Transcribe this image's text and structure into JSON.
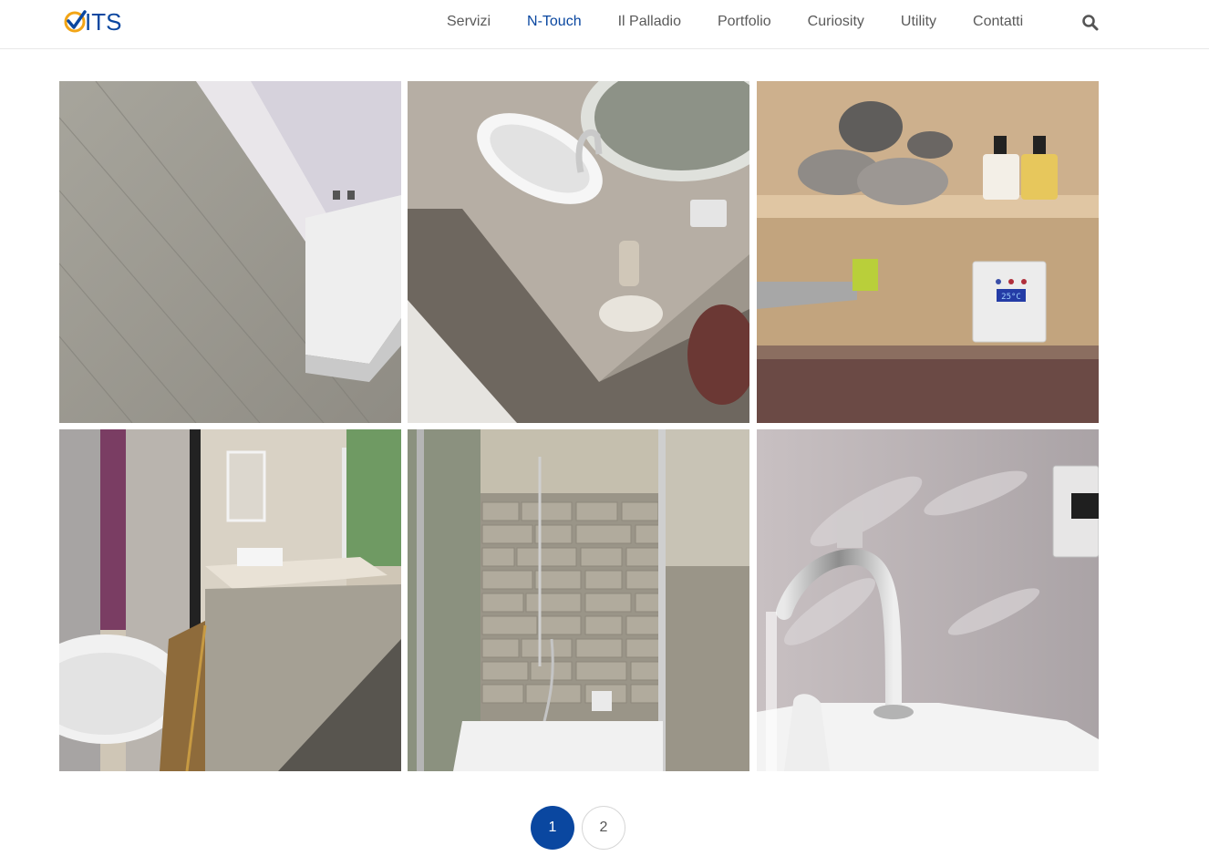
{
  "brand": {
    "logo_text": "ITS"
  },
  "nav": {
    "items": [
      {
        "label": "Servizi",
        "active": false
      },
      {
        "label": "N-Touch",
        "active": true
      },
      {
        "label": "Il Palladio",
        "active": false
      },
      {
        "label": "Portfolio",
        "active": false
      },
      {
        "label": "Curiosity",
        "active": false
      },
      {
        "label": "Utility",
        "active": false
      },
      {
        "label": "Contatti",
        "active": false
      }
    ],
    "search_icon": "search-icon"
  },
  "gallery": {
    "tiles": [
      {
        "subject": "bathroom-floor-and-vanity"
      },
      {
        "subject": "vessel-sink-with-mirror"
      },
      {
        "subject": "towels-shelf-with-thermostat"
      },
      {
        "subject": "bathroom-with-bathtub"
      },
      {
        "subject": "shower-with-stone-tiles"
      },
      {
        "subject": "chrome-faucet"
      }
    ],
    "thermostat_readout": "25°C"
  },
  "pagination": {
    "current": "1",
    "next": "2"
  },
  "colors": {
    "accent": "#0a47a0",
    "logo_check": "#f2a516"
  }
}
